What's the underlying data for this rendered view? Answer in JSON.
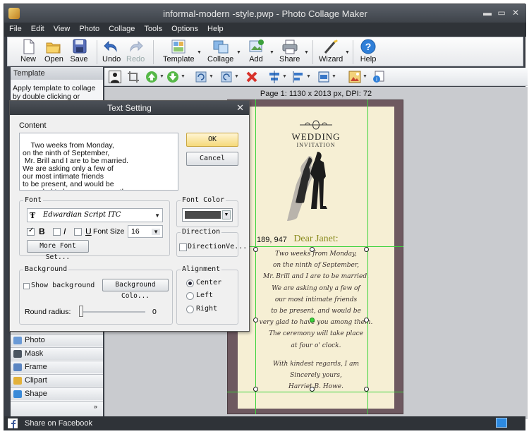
{
  "window": {
    "title": "informal-modern -style.pwp - Photo Collage Maker"
  },
  "menu": [
    "File",
    "Edit",
    "View",
    "Photo",
    "Collage",
    "Tools",
    "Options",
    "Help"
  ],
  "toolbar": {
    "new": "New",
    "open": "Open",
    "save": "Save",
    "undo": "Undo",
    "redo": "Redo",
    "template": "Template",
    "collage": "Collage",
    "add": "Add",
    "share": "Share",
    "wizard": "Wizard",
    "help": "Help"
  },
  "left_panel": {
    "header": "Template",
    "description": "Apply template to collage by double clicking or dragging",
    "items": [
      "Photo",
      "Mask",
      "Frame",
      "Clipart",
      "Shape"
    ]
  },
  "canvas": {
    "page_info": "Page 1: 1130 x 2013 px, DPI: 72",
    "coordinates": "189, 947"
  },
  "card": {
    "title": "WEDDING",
    "subtitle": "INVITATION",
    "greeting": "Dear Janet:",
    "body": "Two weeks from Monday,\non the ninth of September,\nMr. Brill and I are to be married.\nWe are asking only a few of\nour most intimate friends\nto be present, and would be\nvery glad to have you among them.\nThe ceremony will take place\nat four o' clock.",
    "closing": "With kindest regards, I am\nSincerely yours,\nHarriet B. Howe."
  },
  "dialog": {
    "title": "Text Setting",
    "content_label": "Content",
    "content": "Two weeks from Monday,\non the ninth of September,\n Mr. Brill and I are to be married.\nWe are asking only a few of\nour most intimate friends\nto be present, and would be\nvery glad to have you among them.",
    "ok": "OK",
    "cancel": "Cancel",
    "font_group": "Font",
    "font_name": "Edwardian Script ITC",
    "bold": "B",
    "italic": "I",
    "underline": "U",
    "font_size_label": "Font Size",
    "font_size": "16",
    "more_font": "More Font Set...",
    "font_color_group": "Font Color",
    "font_color": "#4a4a4a",
    "direction_group": "Direction",
    "direction_vertical": "DirectionVe...",
    "background_group": "Background",
    "show_background": "Show background",
    "background_color": "Background Colo...",
    "round_radius_label": "Round radius:",
    "round_radius": "0",
    "alignment_group": "Alignment",
    "align_center": "Center",
    "align_left": "Left",
    "align_right": "Right",
    "alignment_selected": "Center"
  },
  "status": {
    "share_facebook": "Share on Facebook"
  }
}
